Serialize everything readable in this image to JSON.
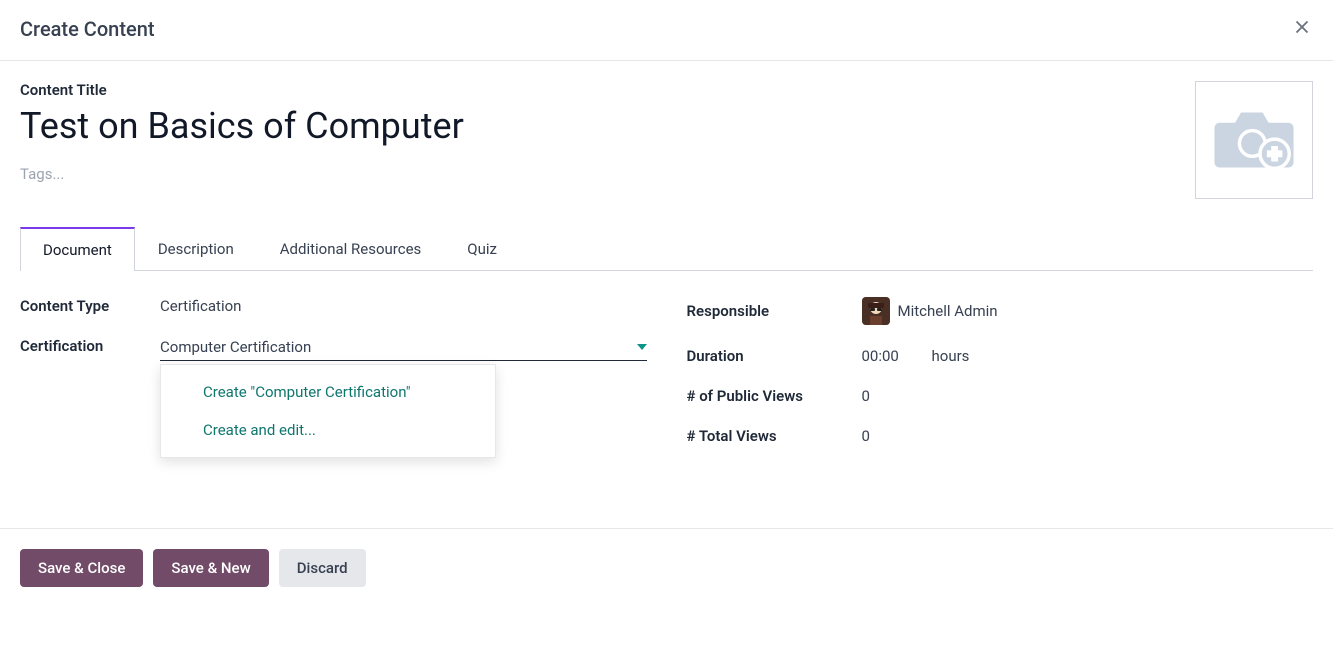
{
  "header": {
    "title": "Create Content"
  },
  "title_block": {
    "label": "Content Title",
    "value": "Test on Basics of Computer",
    "tags_placeholder": "Tags..."
  },
  "tabs": [
    {
      "label": "Document",
      "active": true
    },
    {
      "label": "Description",
      "active": false
    },
    {
      "label": "Additional Resources",
      "active": false
    },
    {
      "label": "Quiz",
      "active": false
    }
  ],
  "left_fields": {
    "content_type": {
      "label": "Content Type",
      "value": "Certification"
    },
    "certification": {
      "label": "Certification",
      "value": "Computer Certification"
    }
  },
  "dropdown": {
    "option_create": "Create \"Computer Certification\"",
    "option_create_edit": "Create and edit..."
  },
  "right_fields": {
    "responsible": {
      "label": "Responsible",
      "value": "Mitchell Admin"
    },
    "duration": {
      "label": "Duration",
      "value": "00:00",
      "unit": "hours"
    },
    "public_views": {
      "label": "# of Public Views",
      "value": "0"
    },
    "total_views": {
      "label": "# Total Views",
      "value": "0"
    }
  },
  "footer": {
    "save_close": "Save & Close",
    "save_new": "Save & New",
    "discard": "Discard"
  },
  "icons": {
    "close": "close-icon",
    "image_upload": "camera-plus-icon",
    "caret": "chevron-down-icon"
  }
}
